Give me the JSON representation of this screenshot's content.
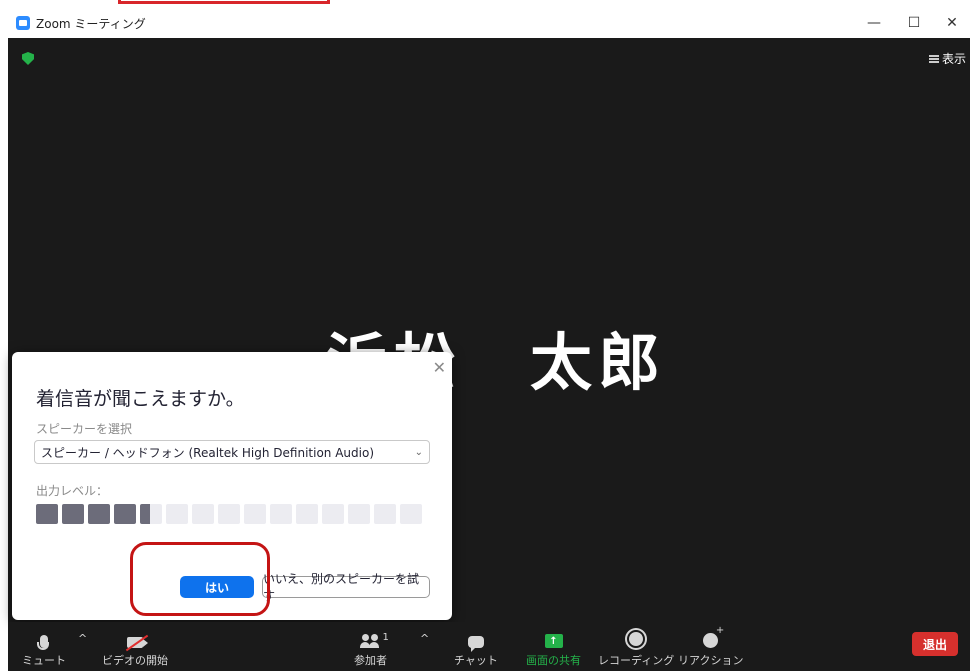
{
  "window": {
    "title": "Zoom ミーティング",
    "minimize_glyph": "—",
    "maximize_glyph": "☐",
    "close_glyph": "✕"
  },
  "view_button": {
    "label": "表示",
    "icon": "grid-icon"
  },
  "participant": {
    "name": "浜松　太郎"
  },
  "dialog": {
    "title": "着信音が聞こえますか。",
    "speaker_label": "スピーカーを選択",
    "speaker_selected": "スピーカー / ヘッドフォン (Realtek High Definition Audio)",
    "output_level_label": "出力レベル：",
    "output_level_fraction": 0.3,
    "yes_label": "はい",
    "no_label": "いいえ、別のスピーカーを試す",
    "close_glyph": "✕"
  },
  "toolbar": {
    "mute_label": "ミュート",
    "video_label": "ビデオの開始",
    "participants_label": "参加者",
    "participants_count": "1",
    "chat_label": "チャット",
    "share_label": "画面の共有",
    "record_label": "レコーディング",
    "reaction_label": "リアクション",
    "leave_label": "退出",
    "caret_glyph": "^"
  },
  "colors": {
    "accent_blue": "#0e72ed",
    "share_green": "#24b24a",
    "leave_red": "#d6302d",
    "annotation_red": "#c41414"
  }
}
